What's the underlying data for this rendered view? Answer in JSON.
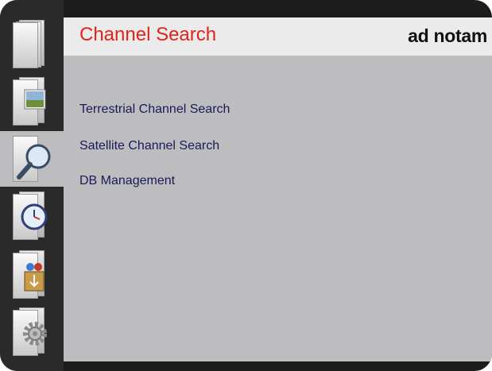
{
  "header": {
    "title": "Channel Search",
    "logo": "ad notam"
  },
  "menu": [
    {
      "label": "Terrestrial Channel Search"
    },
    {
      "label": "Satellite Channel Search"
    },
    {
      "label": "DB Management"
    }
  ],
  "sidebar": {
    "items": [
      {
        "icon": "documents-icon",
        "active": false
      },
      {
        "icon": "pictures-icon",
        "active": false
      },
      {
        "icon": "search-icon",
        "active": true
      },
      {
        "icon": "clock-icon",
        "active": false
      },
      {
        "icon": "install-icon",
        "active": false
      },
      {
        "icon": "settings-gear-icon",
        "active": false
      }
    ]
  },
  "colors": {
    "title": "#e2231a",
    "menu_text": "#1a1a5a",
    "panel": "#bdbcbf",
    "frame": "#1c1c1c"
  }
}
